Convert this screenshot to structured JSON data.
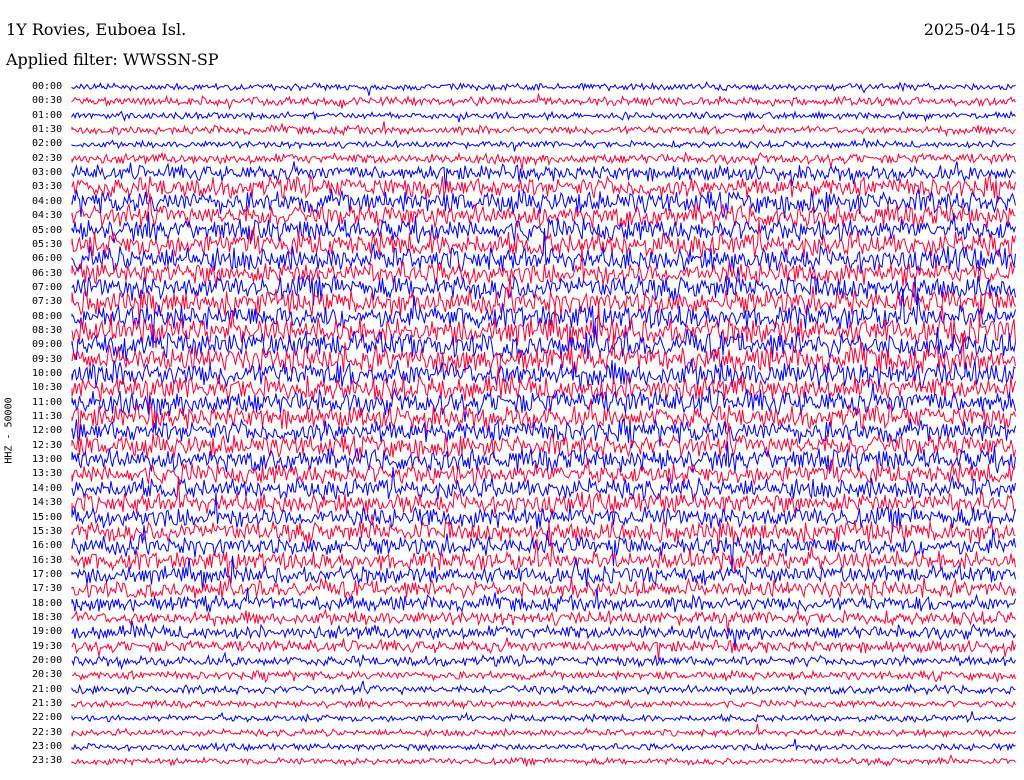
{
  "header": {
    "station": "1Y Rovies, Euboea Isl.",
    "filter": "Applied filter: WWSSN-SP",
    "date": "2025-04-15"
  },
  "chart_data": {
    "type": "line",
    "title": "1Y Rovies, Euboea Isl.",
    "subtitle": "Applied filter: WWSSN-SP",
    "ylabel": "HHZ - 50000",
    "row_labels": [
      "00:00",
      "00:30",
      "01:00",
      "01:30",
      "02:00",
      "02:30",
      "03:00",
      "03:30",
      "04:00",
      "04:30",
      "05:00",
      "05:30",
      "06:00",
      "06:30",
      "07:00",
      "07:30",
      "08:00",
      "08:30",
      "09:00",
      "09:30",
      "10:00",
      "10:30",
      "11:00",
      "11:30",
      "12:00",
      "12:30",
      "13:00",
      "13:30",
      "14:00",
      "14:30",
      "15:00",
      "15:30",
      "16:00",
      "16:30",
      "17:00",
      "17:30",
      "18:00",
      "18:30",
      "19:00",
      "19:30",
      "20:00",
      "20:30",
      "21:00",
      "21:30",
      "22:00",
      "22:30",
      "23:00",
      "23:30"
    ],
    "row_amplitude": [
      4,
      5,
      4,
      5,
      4,
      6,
      9,
      12,
      13,
      13,
      13,
      14,
      14,
      13,
      14,
      14,
      14,
      15,
      15,
      15,
      15,
      14,
      14,
      13,
      13,
      13,
      13,
      12,
      12,
      12,
      12,
      12,
      11,
      11,
      10,
      10,
      9,
      8,
      8,
      7,
      6,
      5,
      5,
      4,
      4,
      4,
      4,
      4
    ],
    "series_colors": [
      "#0000ff",
      "#ff0033"
    ]
  }
}
